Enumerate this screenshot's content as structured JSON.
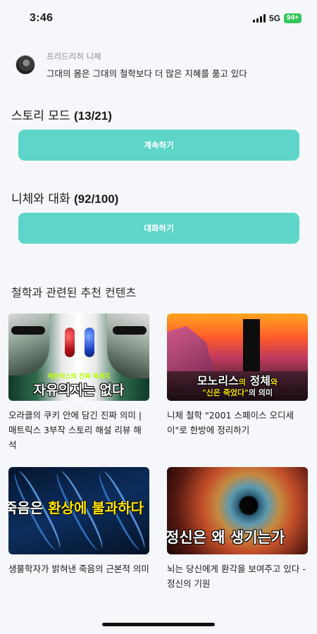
{
  "status_bar": {
    "time": "3:46",
    "network": "5G",
    "battery": "94+"
  },
  "quote": {
    "author": "프리드리히 니체",
    "text": "그대의 몸은 그대의 철학보다 더 많은 지혜를 품고 있다"
  },
  "story": {
    "title": "스토리 모드",
    "count": "(13/21)",
    "button_label": "계속하기"
  },
  "chat": {
    "title": "니체와 대화",
    "count": "(92/100)",
    "button_label": "대화하기"
  },
  "recommendations": {
    "title": "철학과 관련된 추천 컨텐츠",
    "items": [
      {
        "title": "오라클의 쿠키 안에 담긴 진짜 의미 | 매트릭스 3부작 스토리 해설 리뷰 해석",
        "thumb_small": "매트릭스의 진짜 메세지",
        "thumb_big": "자유의지는 없다"
      },
      {
        "title": "니체 철학 \"2001 스페이스 오디세이\"로 한방에 정리하기",
        "thumb_a": "모노리스",
        "thumb_b": "의",
        "thumb_c": "정체",
        "thumb_d": "와",
        "thumb_e": "\"신은 죽었다\"",
        "thumb_f": "의 의미"
      },
      {
        "title": "생물학자가 밝혀낸 죽음의 근본적 의미",
        "thumb_a": "죽음은 ",
        "thumb_b": "환상에 불과하다"
      },
      {
        "title": "뇌는 당신에게 환각을 보여주고 있다 - 정신의 기원",
        "thumb_a": "정신은 왜 생기는가"
      }
    ]
  },
  "colors": {
    "accent": "#5dd6c9",
    "background": "#f5f7fa",
    "battery": "#34c759"
  }
}
